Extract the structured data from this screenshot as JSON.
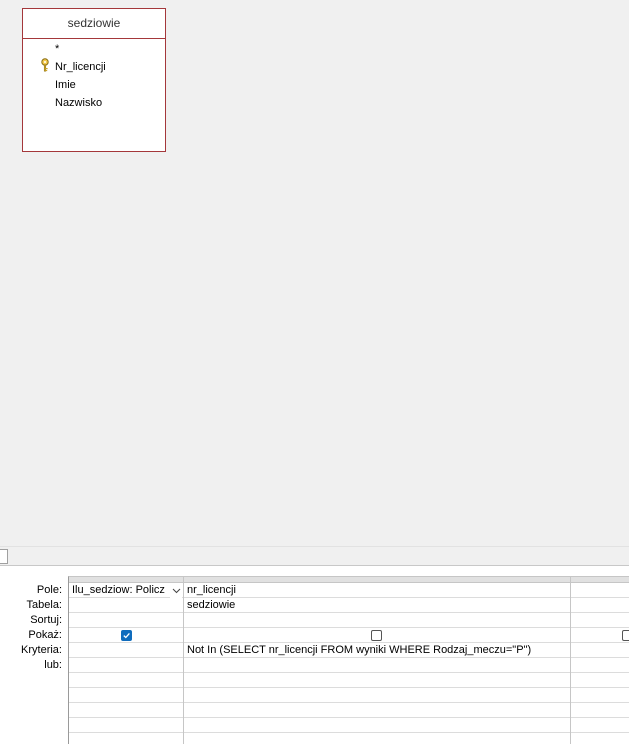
{
  "table_pane": {
    "table": {
      "name": "sedziowie",
      "fields": [
        {
          "label": "*",
          "primary_key": false
        },
        {
          "label": "Nr_licencji",
          "primary_key": true
        },
        {
          "label": "Imie",
          "primary_key": false
        },
        {
          "label": "Nazwisko",
          "primary_key": false
        }
      ]
    }
  },
  "grid": {
    "row_labels": {
      "pole": "Pole:",
      "tabela": "Tabela:",
      "sortuj": "Sortuj:",
      "pokaz": "Pokaż:",
      "kryteria": "Kryteria:",
      "lub": "lub:"
    },
    "columns": [
      {
        "field": "Ilu_sedziow: Policz",
        "table": "",
        "sort": "",
        "show": true,
        "criteria": "",
        "or": ""
      },
      {
        "field": "nr_licencji",
        "table": "sedziowie",
        "sort": "",
        "show": false,
        "criteria": "Not In (SELECT nr_licencji FROM wyniki WHERE Rodzaj_meczu=\"P\")",
        "or": ""
      },
      {
        "field": "",
        "table": "",
        "sort": "",
        "show": false,
        "criteria": "",
        "or": ""
      }
    ]
  },
  "colors": {
    "table_border": "#a4373a",
    "checkbox_checked": "#0f6cbd"
  },
  "icons": {
    "primary_key": "key-icon",
    "dropdown": "chevron-down-icon",
    "checkmark": "check-icon"
  }
}
